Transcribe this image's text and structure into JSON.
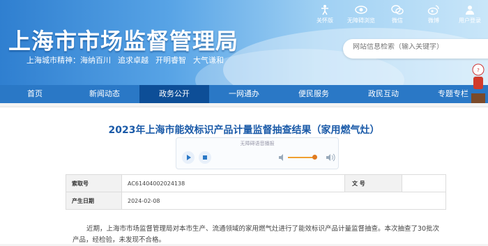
{
  "header": {
    "title": "上海市市场监督管理局",
    "motto_prefix": "上海城市精神：",
    "motto": [
      "海纳百川",
      "追求卓越",
      "开明睿智",
      "大气谦和"
    ],
    "tools": [
      {
        "label": "关怀版",
        "icon": "accessibility-icon"
      },
      {
        "label": "无障碍浏览",
        "icon": "eye-icon"
      },
      {
        "label": "微信",
        "icon": "wechat-icon"
      },
      {
        "label": "微博",
        "icon": "weibo-icon"
      },
      {
        "label": "用户登录",
        "icon": "user-icon"
      }
    ],
    "search_placeholder": "网站信息检索（输入关键字）"
  },
  "nav": {
    "items": [
      "首页",
      "新闻动态",
      "政务公开",
      "一网通办",
      "便民服务",
      "政民互动",
      "专题专栏"
    ],
    "active_index": 2
  },
  "article": {
    "title": "2023年上海市能效标识产品计量监督抽查结果（家用燃气灶）",
    "player_caption": "无障碍语音播报",
    "meta": {
      "index_label": "索取号",
      "index_value": "AC61404002024138",
      "docno_label": "文 号",
      "docno_value": "",
      "date_label": "产生日期",
      "date_value": "2024-02-08"
    },
    "body": "近期，上海市市场监督管理局对本市生产、流通领域的家用燃气灶进行了能效标识产品计量监督抽查。本次抽查了30批次产品，经检验，未发现不合格。"
  },
  "colors": {
    "nav_bg": "#2a78c6",
    "nav_active": "#0d4e97",
    "title_blue": "#1a5aa8",
    "volume_orange": "#f0a030"
  }
}
